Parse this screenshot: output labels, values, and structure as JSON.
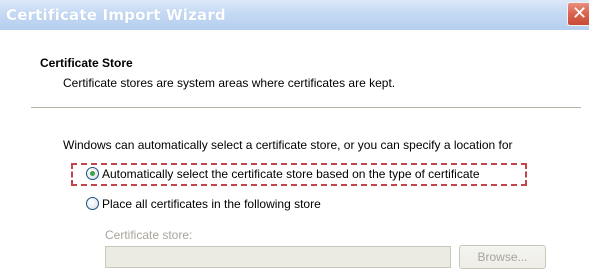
{
  "window": {
    "title": "Certificate Import Wizard",
    "close_glyph": "✕"
  },
  "header": {
    "title": "Certificate Store",
    "subtitle": "Certificate stores are system areas where certificates are kept."
  },
  "body": {
    "intro": "Windows can automatically select a certificate store, or you can specify a location for",
    "options": [
      {
        "label": "Automatically select the certificate store based on the type of certificate",
        "selected": true
      },
      {
        "label": "Place all certificates in the following store",
        "selected": false
      }
    ],
    "store_label": "Certificate store:",
    "store_value": "",
    "browse_label": "Browse..."
  },
  "colors": {
    "title_gradient_top": "#dde9f8",
    "title_gradient_bottom": "#b6cfef",
    "close_button": "#d8644e",
    "highlight_dash": "#c0464c",
    "disabled_text": "#a7a59a"
  },
  "icons": {
    "close": "close-icon",
    "radio_selected": "radio-selected-icon",
    "radio_unselected": "radio-unselected-icon"
  }
}
